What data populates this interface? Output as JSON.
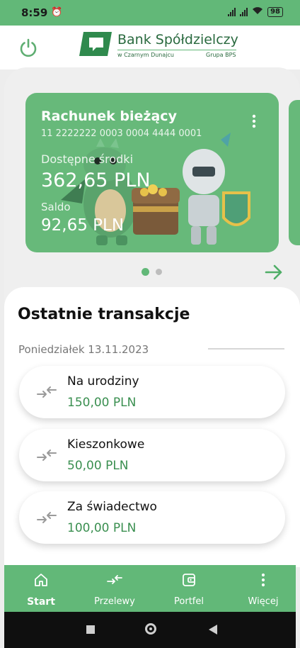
{
  "status": {
    "time": "8:59",
    "battery": "98"
  },
  "brand": {
    "name": "Bank Spółdzielczy",
    "sub": "w Czarnym Dunajcu",
    "group": "Grupa BPS"
  },
  "account": {
    "title": "Rachunek bieżący",
    "number": "11 2222222 0003 0004 4444 0001",
    "available_label": "Dostępne środki",
    "available": "362,65 PLN",
    "balance_label": "Saldo",
    "balance": "92,65 PLN"
  },
  "carousel": {
    "pages": 2,
    "active": 1
  },
  "transactions": {
    "title": "Ostatnie transakcje",
    "date": "Poniedziałek 13.11.2023",
    "items": [
      {
        "name": "Na urodziny",
        "amount": "150,00 PLN"
      },
      {
        "name": "Kieszonkowe",
        "amount": "50,00 PLN"
      },
      {
        "name": "Za świadectwo",
        "amount": "100,00 PLN"
      }
    ]
  },
  "nav": {
    "items": [
      {
        "label": "Start",
        "icon": "home-icon"
      },
      {
        "label": "Przelewy",
        "icon": "transfer-icon"
      },
      {
        "label": "Portfel",
        "icon": "wallet-icon"
      },
      {
        "label": "Więcej",
        "icon": "more-icon"
      }
    ]
  },
  "colors": {
    "accent": "#62b878",
    "card": "#67b97a",
    "amount": "#3a8f50"
  }
}
